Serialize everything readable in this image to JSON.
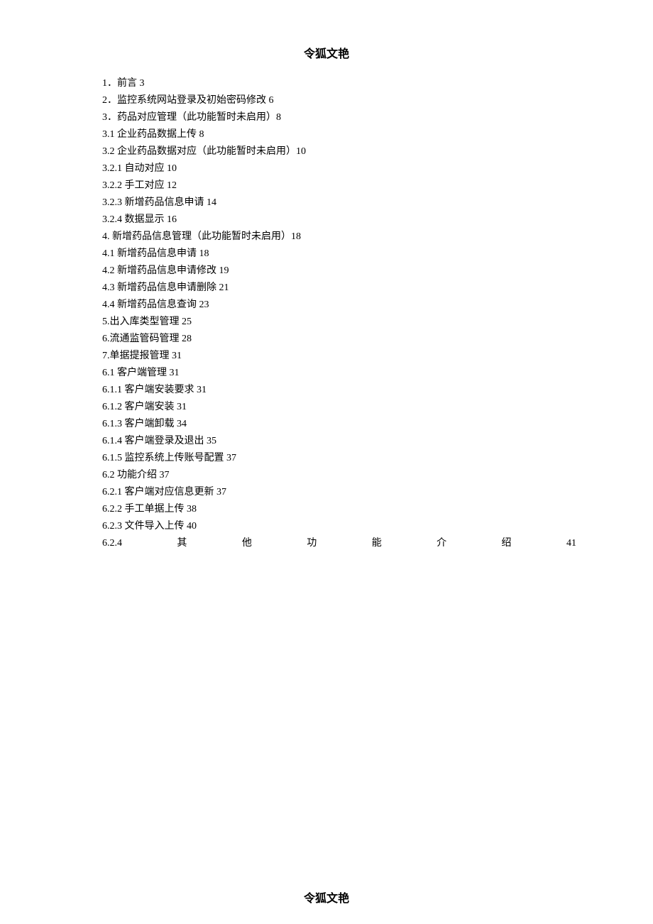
{
  "header": "令狐文艳",
  "footer": "令狐文艳",
  "toc": {
    "lines": [
      "1．前言 3",
      "2．监控系统网站登录及初始密码修改 6",
      "3．药品对应管理（此功能暂时未启用）8",
      "3.1 企业药品数据上传 8",
      "3.2 企业药品数据对应（此功能暂时未启用）10",
      "3.2.1 自动对应 10",
      "3.2.2 手工对应 12",
      "3.2.3 新增药品信息申请 14",
      "3.2.4 数据显示 16",
      "4. 新增药品信息管理（此功能暂时未启用）18",
      "4.1 新增药品信息申请 18",
      "4.2 新增药品信息申请修改 19",
      "4.3 新增药品信息申请删除 21",
      "4.4 新增药品信息查询 23",
      "5.出入库类型管理 25",
      "6.流通监管码管理 28",
      "7.单据提报管理 31",
      "6.1 客户端管理 31",
      "6.1.1 客户端安装要求 31",
      "6.1.2 客户端安装 31",
      "6.1.3 客户端卸载 34",
      "6.1.4 客户端登录及退出 35",
      "6.1.5 监控系统上传账号配置 37",
      "6.2 功能介绍 37",
      "6.2.1 客户端对应信息更新 37",
      "6.2.2 手工单据上传 38",
      "6.2.3 文件导入上传 40"
    ],
    "justified_line": {
      "parts": [
        "6.2.4",
        "其",
        "他",
        "功",
        "能",
        "介",
        "绍",
        "41"
      ]
    }
  }
}
